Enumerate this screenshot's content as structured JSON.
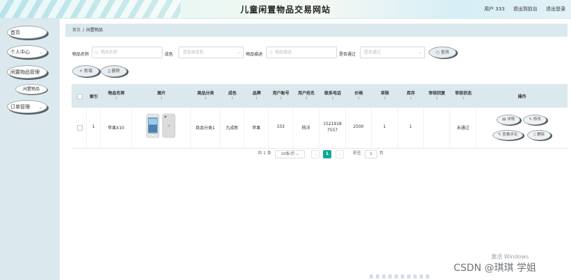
{
  "header": {
    "title": "儿童闲置物品交易网站",
    "user": "用户 333",
    "back_front": "退出到前台",
    "logout": "退出登录"
  },
  "sidebar": {
    "items": [
      {
        "label": "首页",
        "chevron": ""
      },
      {
        "label": "个人中心",
        "chevron": "⌄"
      },
      {
        "label": "闲置物品管理",
        "chevron": "⌃"
      },
      {
        "label": "订单管理",
        "chevron": "⌄"
      }
    ],
    "sub_label": "闲置物品"
  },
  "breadcrumb": {
    "home": "首页",
    "sep": "/",
    "current": "闲置物品"
  },
  "filters": {
    "name_label": "物品名称",
    "name_placeholder": "物品名称",
    "condition_label": "成色",
    "condition_placeholder": "请选择成色",
    "desc_label": "物品描述",
    "desc_placeholder": "物品描述",
    "approved_label": "是否通过",
    "approved_placeholder": "是否通过",
    "search_label": "查询"
  },
  "actions": {
    "add": "新增",
    "delete": "删除"
  },
  "table": {
    "columns": [
      {
        "label": "",
        "sort": ""
      },
      {
        "label": "索引",
        "sort": ""
      },
      {
        "label": "物品名称",
        "sort": "⇕"
      },
      {
        "label": "图片",
        "sort": "⇕"
      },
      {
        "label": "商品分类",
        "sort": "⇕"
      },
      {
        "label": "成色",
        "sort": "⇕"
      },
      {
        "label": "品牌",
        "sort": "⇕"
      },
      {
        "label": "用户账号",
        "sort": "⇕"
      },
      {
        "label": "用户姓名",
        "sort": "⇕"
      },
      {
        "label": "联系电话",
        "sort": "⇕"
      },
      {
        "label": "价格",
        "sort": "⇕"
      },
      {
        "label": "单限",
        "sort": "⇕"
      },
      {
        "label": "库存",
        "sort": "⇕"
      },
      {
        "label": "审核回复",
        "sort": "⇕"
      },
      {
        "label": "审核状态",
        "sort": "⇕"
      },
      {
        "label": "操作",
        "sort": ""
      }
    ],
    "row": {
      "index": "1",
      "name": "苹果X10",
      "category": "商品分类1",
      "condition": "九成新",
      "brand": "苹果",
      "account": "333",
      "username": "杨洋",
      "phone_1": "1521918",
      "phone_2": "7557",
      "price": "2500",
      "limit": "1",
      "stock": "1",
      "reply": "",
      "status": "未通过"
    },
    "row_actions": {
      "detail": "详情",
      "edit": "修改",
      "review": "查看评论",
      "delete": "删除"
    }
  },
  "pagination": {
    "total": "共 1 条",
    "page_size": "10条/页",
    "prev": "‹",
    "current": "1",
    "next": "›",
    "goto_prefix": "前往",
    "goto_value": "1",
    "goto_suffix": "页"
  },
  "overlay": {
    "activate": "激活 Windows",
    "activate_sub": "转到\"设置\"以激活 Windows。",
    "csdn": "CSDN @琪琪 学姐"
  },
  "colors": {
    "sidebar": "#dbe9ee",
    "accent": "#1aab9b",
    "page_active": "#10a79a"
  }
}
